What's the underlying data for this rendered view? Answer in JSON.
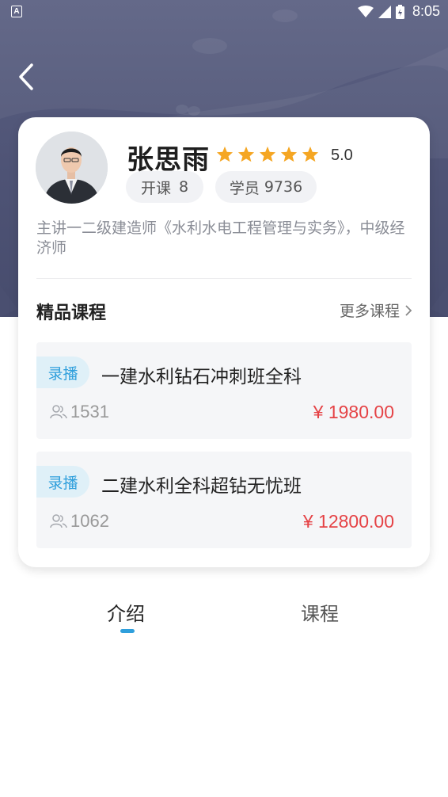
{
  "status_bar": {
    "left_icon": "A",
    "time": "8:05",
    "icons": [
      "wifi-icon",
      "signal-icon",
      "battery-icon"
    ]
  },
  "header": {
    "back_icon": "chevron-left-icon"
  },
  "teacher": {
    "name": "张思雨",
    "rating": "5.0",
    "stars": 5,
    "courses_label": "开课",
    "courses_count": "8",
    "students_label": "学员",
    "students_count": "9736",
    "bio": "主讲一二级建造师《水利水电工程管理与实务》，中级经济师"
  },
  "section": {
    "title": "精品课程",
    "more_label": "更多课程"
  },
  "courses": [
    {
      "tag": "录播",
      "title": "一建水利钻石冲刺班全科",
      "students": "1531",
      "price": "¥ 1980.00"
    },
    {
      "tag": "录播",
      "title": "二建水利全科超钻无忧班",
      "students": "1062",
      "price": "¥ 12800.00"
    }
  ],
  "tabs": [
    {
      "label": "介绍",
      "active": true
    },
    {
      "label": "课程",
      "active": false
    }
  ],
  "colors": {
    "header_bg": "#4e5375",
    "accent": "#2f9fdc",
    "price": "#e54245",
    "star": "#f5a623"
  }
}
